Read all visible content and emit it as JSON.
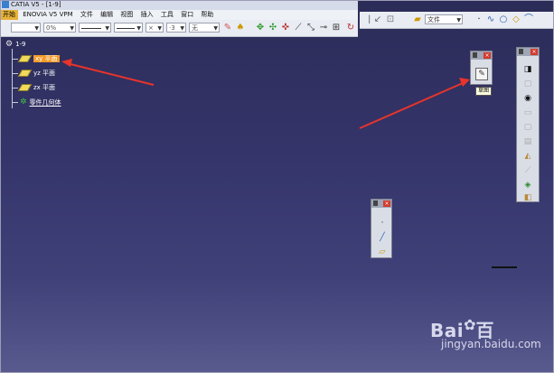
{
  "window": {
    "title": "CATIA V5 - [1-9]"
  },
  "menu": {
    "items": [
      "开始",
      "ENOVIA V5 VPM",
      "文件",
      "编辑",
      "视图",
      "插入",
      "工具",
      "窗口",
      "帮助"
    ]
  },
  "toolbar": {
    "color_combo": "",
    "transparency_combo": "0%",
    "linetype_combo": "",
    "lineweight_combo": "",
    "point_combo": "×",
    "layer_num": "·3",
    "layer_combo": "无",
    "file_combo": "文件"
  },
  "tree": {
    "root": "1-9",
    "items": [
      {
        "label": "xy 平面",
        "highlighted": true
      },
      {
        "label": "yz 平面",
        "highlighted": false
      },
      {
        "label": "zx 平面",
        "highlighted": false
      }
    ],
    "body": "零件几何体"
  },
  "sketch_palette": {
    "tooltip": "草图"
  },
  "colors": {
    "background_top": "#2c2c58",
    "background_bottom": "#595a8e",
    "highlight": "#f39a2a",
    "arrow": "#e8342a",
    "close_button": "#d33a2c"
  },
  "watermark": {
    "main": "Bai",
    "main2": "百",
    "sub": "jingyan.baidu.com"
  }
}
